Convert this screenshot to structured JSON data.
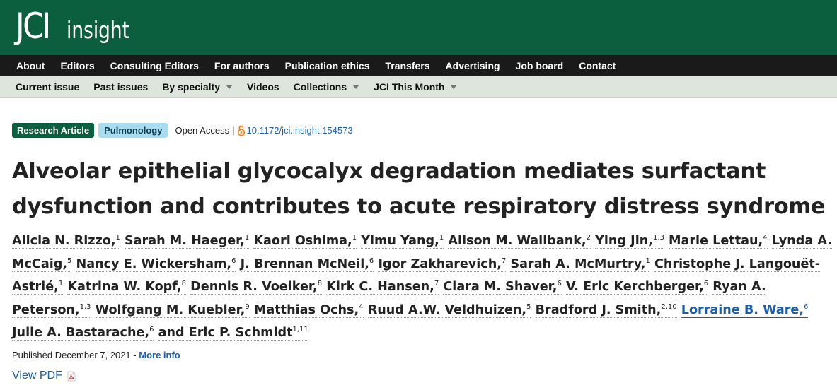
{
  "brand": {
    "logo_main": "JCI",
    "logo_sub": "insight",
    "color": "#0b5e3e"
  },
  "nav_primary": {
    "items": [
      "About",
      "Editors",
      "Consulting Editors",
      "For authors",
      "Publication ethics",
      "Transfers",
      "Advertising",
      "Job board",
      "Contact"
    ]
  },
  "nav_secondary": {
    "items": [
      {
        "label": "Current issue",
        "dropdown": false
      },
      {
        "label": "Past issues",
        "dropdown": false
      },
      {
        "label": "By specialty",
        "dropdown": true
      },
      {
        "label": "Videos",
        "dropdown": false
      },
      {
        "label": "Collections",
        "dropdown": true
      },
      {
        "label": "JCI This Month",
        "dropdown": true
      }
    ]
  },
  "article": {
    "type_badge": "Research Article",
    "specialty_badge": "Pulmonology",
    "access": "Open Access",
    "separator": "|",
    "doi": "10.1172/jci.insight.154573",
    "title": "Alveolar epithelial glycocalyx degradation mediates surfactant dysfunction and contributes to acute respiratory distress syndrome",
    "authors": [
      {
        "name": "Alicia N. Rizzo,",
        "aff": "1",
        "link": false
      },
      {
        "name": "Sarah M. Haeger,",
        "aff": "1",
        "link": false
      },
      {
        "name": "Kaori Oshima,",
        "aff": "1",
        "link": false
      },
      {
        "name": "Yimu Yang,",
        "aff": "1",
        "link": false
      },
      {
        "name": "Alison M. Wallbank,",
        "aff": "2",
        "link": false
      },
      {
        "name": "Ying Jin,",
        "aff": "1,3",
        "link": false
      },
      {
        "name": "Marie Lettau,",
        "aff": "4",
        "link": false
      },
      {
        "name": "Lynda A. McCaig,",
        "aff": "5",
        "link": false
      },
      {
        "name": "Nancy E. Wickersham,",
        "aff": "6",
        "link": false
      },
      {
        "name": "J. Brennan McNeil,",
        "aff": "6",
        "link": false
      },
      {
        "name": "Igor Zakharevich,",
        "aff": "7",
        "link": false
      },
      {
        "name": "Sarah A. McMurtry,",
        "aff": "1",
        "link": false
      },
      {
        "name": "Christophe J. Langouët-Astrié,",
        "aff": "1",
        "link": false
      },
      {
        "name": "Katrina W. Kopf,",
        "aff": "8",
        "link": false
      },
      {
        "name": "Dennis R. Voelker,",
        "aff": "8",
        "link": false
      },
      {
        "name": "Kirk C. Hansen,",
        "aff": "7",
        "link": false
      },
      {
        "name": "Ciara M. Shaver,",
        "aff": "6",
        "link": false
      },
      {
        "name": "V. Eric Kerchberger,",
        "aff": "6",
        "link": false
      },
      {
        "name": "Ryan A. Peterson,",
        "aff": "1,3",
        "link": false
      },
      {
        "name": "Wolfgang M. Kuebler,",
        "aff": "9",
        "link": false
      },
      {
        "name": "Matthias Ochs,",
        "aff": "4",
        "link": false
      },
      {
        "name": "Ruud A.W. Veldhuizen,",
        "aff": "5",
        "link": false
      },
      {
        "name": "Bradford J. Smith,",
        "aff": "2,10",
        "link": false
      },
      {
        "name": "Lorraine B. Ware,",
        "aff": "6",
        "link": true
      },
      {
        "name": "Julie A. Bastarache,",
        "aff": "6",
        "link": false
      },
      {
        "name": "and Eric P. Schmidt",
        "aff": "1,11",
        "link": false
      }
    ],
    "published_label": "Published December 7, 2021",
    "published_sep": " - ",
    "more_info": "More info",
    "view_pdf": "View PDF"
  },
  "colors": {
    "link": "#1d5ea8",
    "nav_primary_bg": "#1a1a1a",
    "nav_secondary_bg": "#dde5dc",
    "specialty_badge_bg": "#a8dcef"
  },
  "icons": {
    "open_access": "open-access-lock-icon",
    "pdf": "pdf-file-icon",
    "dropdown": "caret-down-icon"
  }
}
